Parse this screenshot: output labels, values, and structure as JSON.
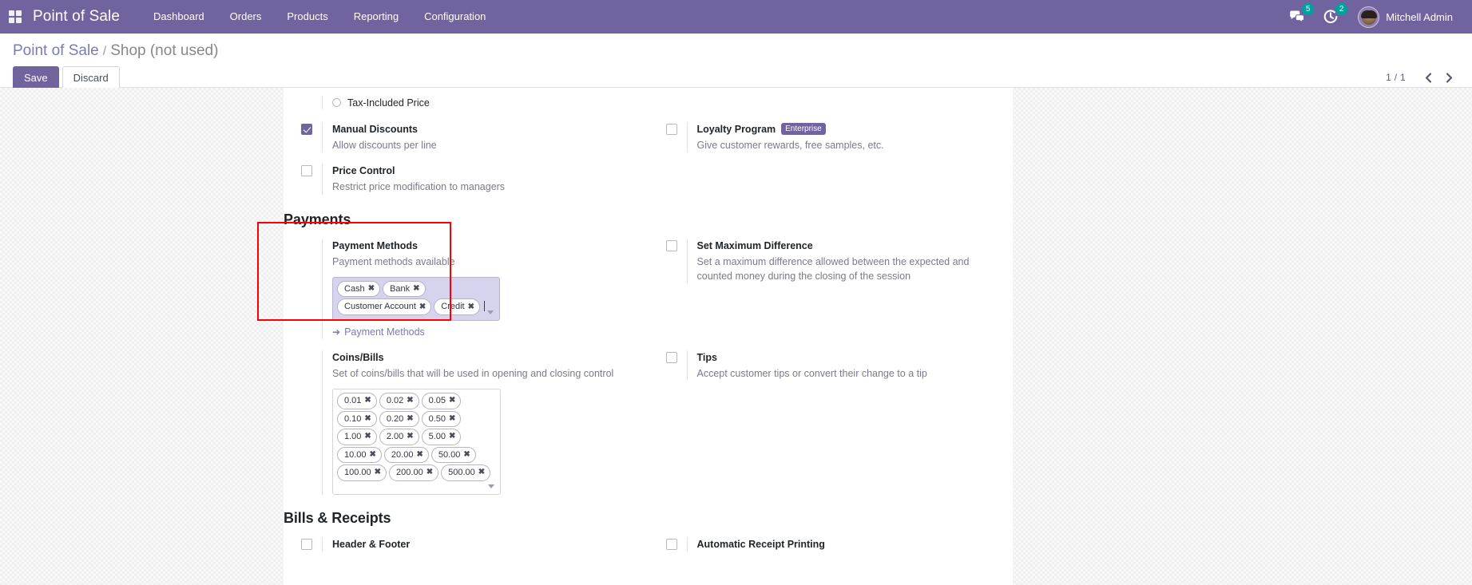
{
  "navbar": {
    "apps_icon": "apps-grid-icon",
    "brand": "Point of Sale",
    "menu": [
      {
        "label": "Dashboard"
      },
      {
        "label": "Orders"
      },
      {
        "label": "Products"
      },
      {
        "label": "Reporting"
      },
      {
        "label": "Configuration"
      }
    ],
    "messages_icon": "messages-icon",
    "messages_count": "5",
    "activities_icon": "activity-clock-icon",
    "activities_count": "2",
    "avatar_icon": "user-avatar",
    "username": "Mitchell Admin",
    "bg_color": "#71639e",
    "badge_color": "#00a09d"
  },
  "control_panel": {
    "breadcrumb_root": "Point of Sale",
    "breadcrumb_separator": "/",
    "breadcrumb_current": "Shop (not used)",
    "save_label": "Save",
    "discard_label": "Discard",
    "pager_value": "1 / 1",
    "prev_icon": "chevron-left-icon",
    "next_icon": "chevron-right-icon"
  },
  "settings": {
    "pricing_tail": {
      "tax_included_radio_label": "Tax-Included Price",
      "tax_included_checked": false
    },
    "rows_pricing": [
      {
        "left": {
          "name": "manual-discounts",
          "title": "Manual Discounts",
          "desc": "Allow discounts per line",
          "checked": true
        },
        "right": {
          "name": "loyalty-program",
          "title": "Loyalty Program",
          "badge": "Enterprise",
          "desc": "Give customer rewards, free samples, etc.",
          "checked": false
        }
      },
      {
        "left": {
          "name": "price-control",
          "title": "Price Control",
          "desc": "Restrict price modification to managers",
          "checked": false
        },
        "right": null
      }
    ],
    "payments_heading": "Payments",
    "payment_methods": {
      "name": "payment-methods",
      "title": "Payment Methods",
      "desc": "Payment methods available",
      "tags": [
        "Cash",
        "Bank",
        "Customer Account",
        "Credit"
      ],
      "tag_remove_glyph": "✖",
      "link_arrow": "➔",
      "link_label": "Payment Methods",
      "highlight_color": "#ff0000",
      "field_bg": "#d6d3ef"
    },
    "set_max_difference": {
      "name": "set-maximum-difference",
      "title": "Set Maximum Difference",
      "desc": "Set a maximum difference allowed between the expected and counted money during the closing of the session",
      "checked": false
    },
    "coins_bills": {
      "name": "coins-bills",
      "title": "Coins/Bills",
      "desc": "Set of coins/bills that will be used in opening and closing control",
      "tags": [
        "0.01",
        "0.02",
        "0.05",
        "0.10",
        "0.20",
        "0.50",
        "1.00",
        "2.00",
        "5.00",
        "10.00",
        "20.00",
        "50.00",
        "100.00",
        "200.00",
        "500.00"
      ]
    },
    "tips": {
      "name": "tips",
      "title": "Tips",
      "desc": "Accept customer tips or convert their change to a tip",
      "checked": false
    },
    "bills_receipts_heading": "Bills & Receipts",
    "bills_receipts_rows": [
      {
        "left": {
          "name": "header-footer",
          "title": "Header & Footer",
          "checked": false
        },
        "right": {
          "name": "automatic-receipt-printing",
          "title": "Automatic Receipt Printing",
          "checked": false
        }
      }
    ]
  }
}
